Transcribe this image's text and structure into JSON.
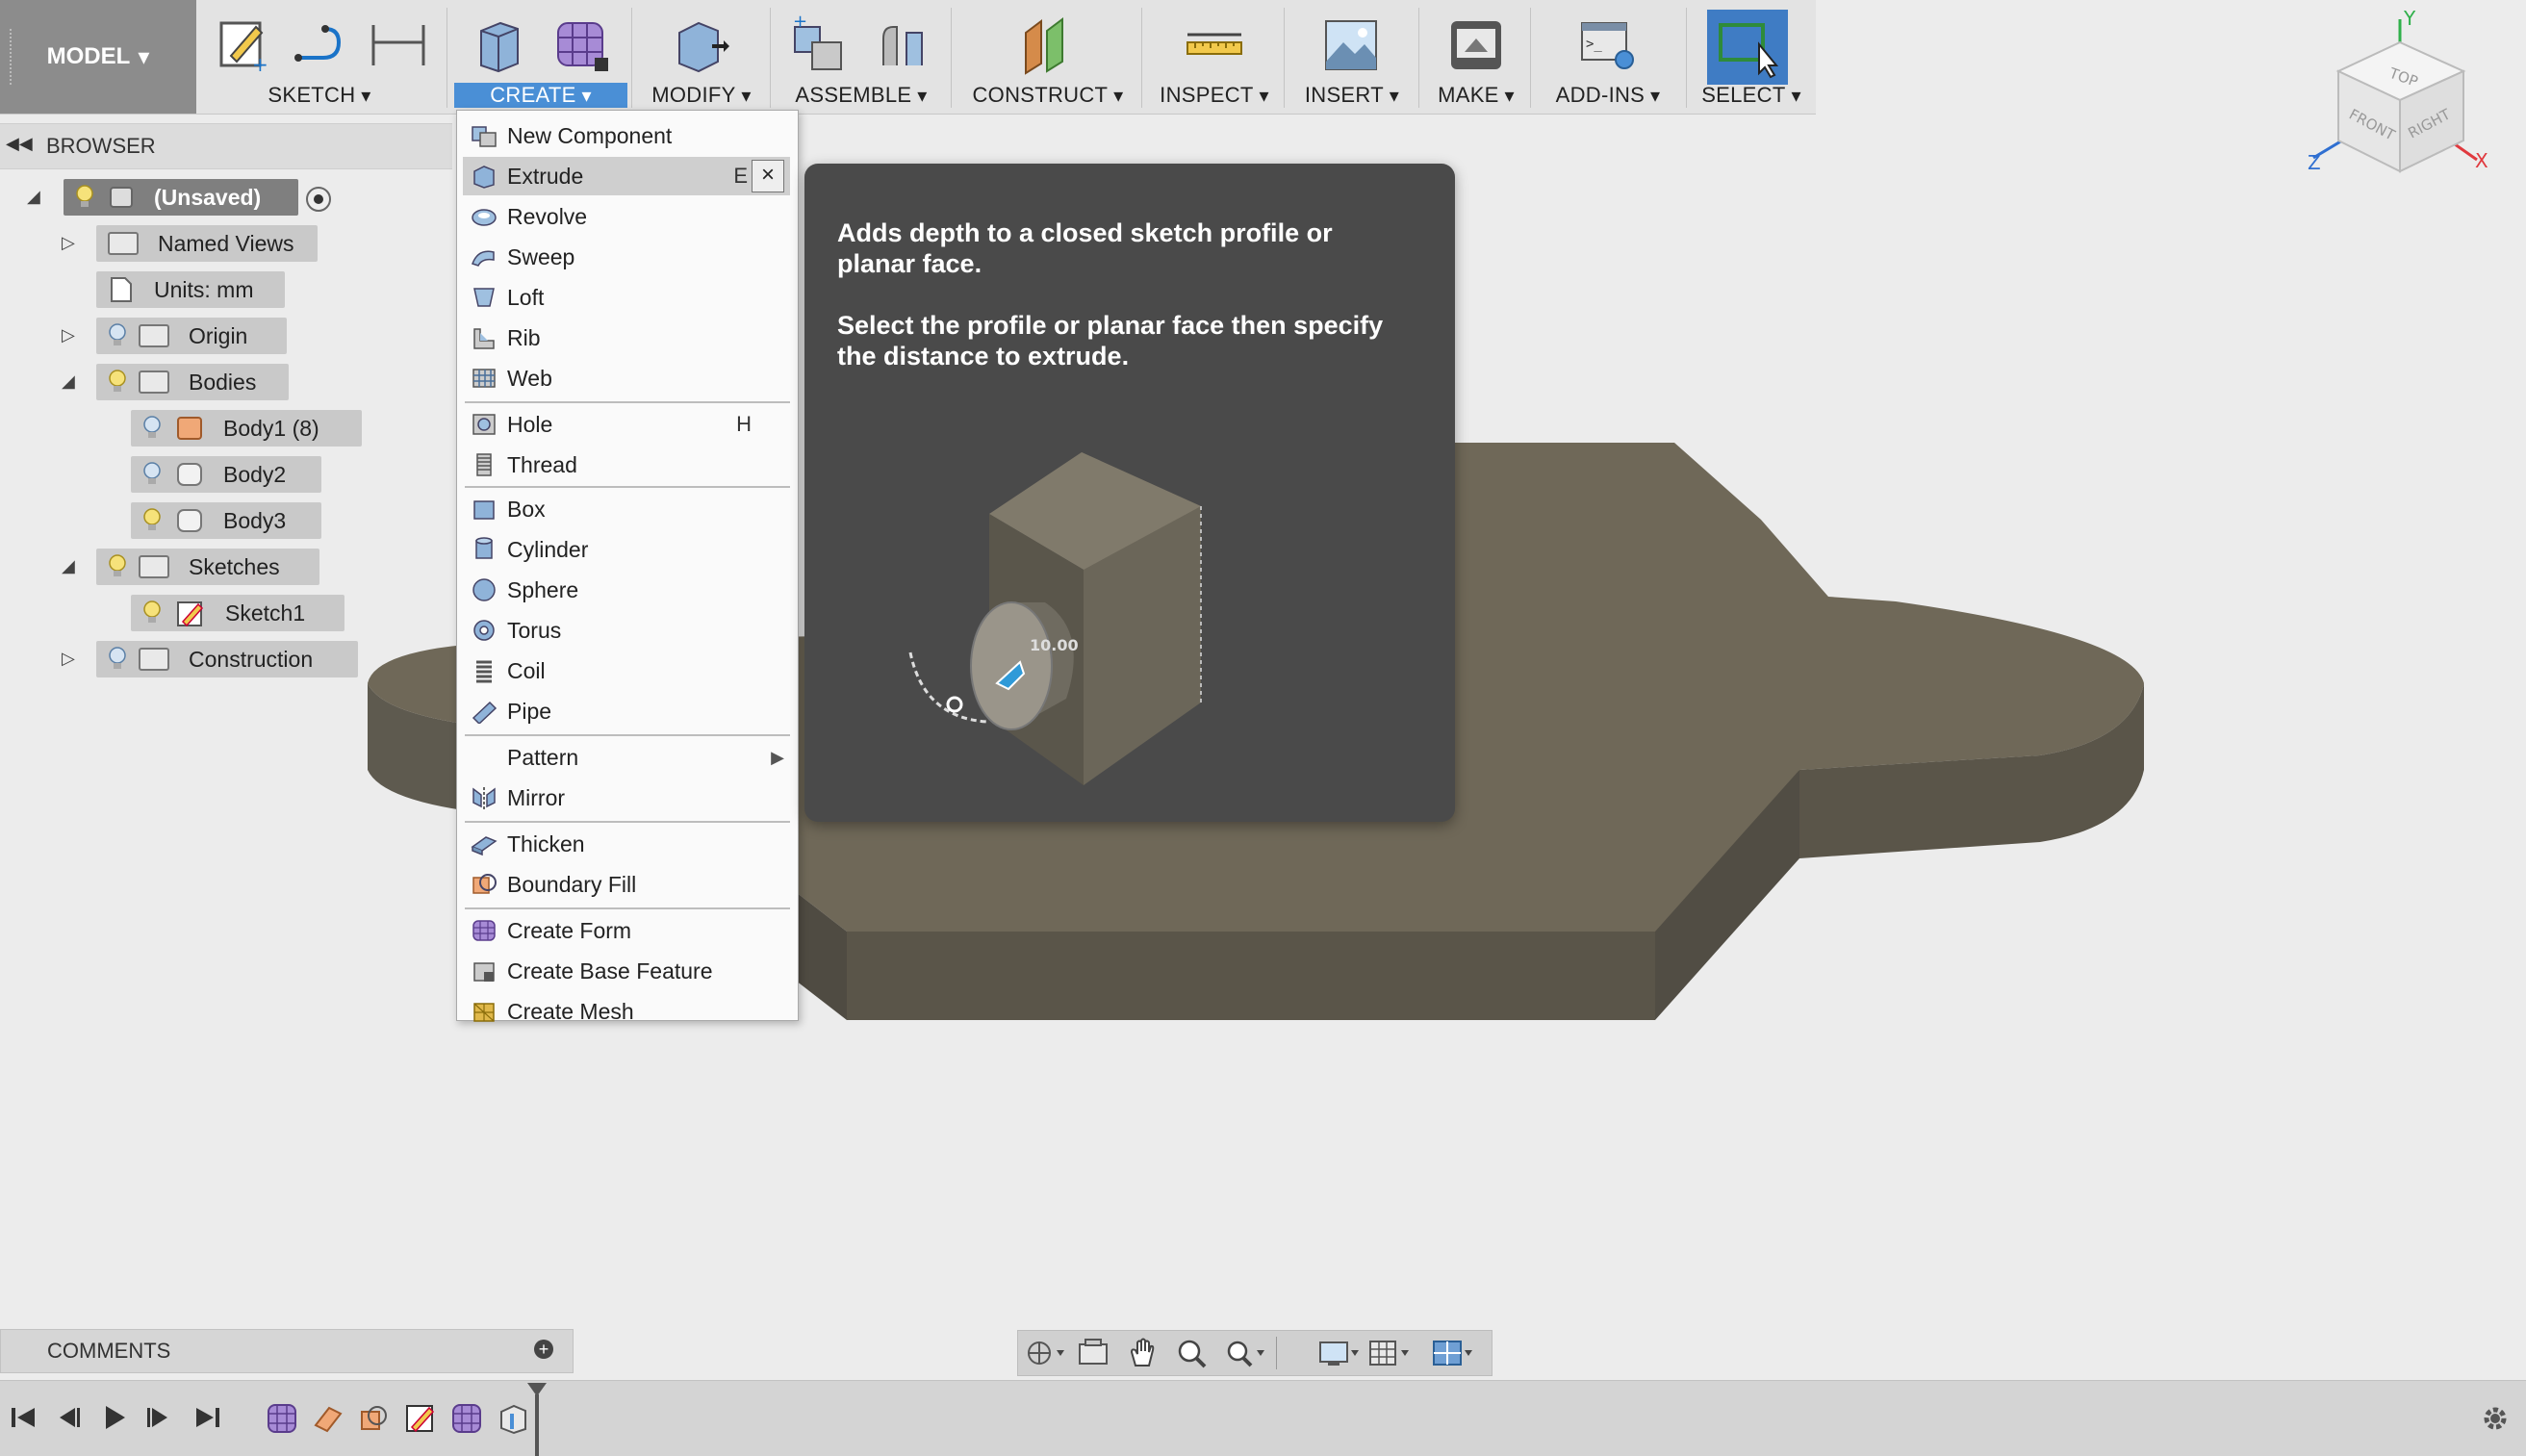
{
  "toolbar": {
    "workspace": "MODEL",
    "groups": [
      "SKETCH",
      "CREATE",
      "MODIFY",
      "ASSEMBLE",
      "CONSTRUCT",
      "INSPECT",
      "INSERT",
      "MAKE",
      "ADD-INS",
      "SELECT"
    ]
  },
  "viewcube": {
    "top": "TOP",
    "front": "FRONT",
    "right": "RIGHT",
    "x": "X",
    "y": "Y",
    "z": "Z"
  },
  "browser": {
    "title": "BROWSER",
    "items": [
      {
        "label": "(Unsaved)"
      },
      {
        "label": "Named Views"
      },
      {
        "label": "Units: mm"
      },
      {
        "label": "Origin"
      },
      {
        "label": "Bodies"
      },
      {
        "label": "Body1 (8)"
      },
      {
        "label": "Body2"
      },
      {
        "label": "Body3"
      },
      {
        "label": "Sketches"
      },
      {
        "label": "Sketch1"
      },
      {
        "label": "Construction"
      }
    ]
  },
  "create_menu": {
    "items": [
      {
        "label": "New Component",
        "shortcut": ""
      },
      {
        "label": "Extrude",
        "shortcut": "E",
        "close": "×"
      },
      {
        "label": "Revolve",
        "shortcut": ""
      },
      {
        "label": "Sweep",
        "shortcut": ""
      },
      {
        "label": "Loft",
        "shortcut": ""
      },
      {
        "label": "Rib",
        "shortcut": ""
      },
      {
        "label": "Web",
        "shortcut": ""
      },
      {
        "label": "Hole",
        "shortcut": "H"
      },
      {
        "label": "Thread",
        "shortcut": ""
      },
      {
        "label": "Box",
        "shortcut": ""
      },
      {
        "label": "Cylinder",
        "shortcut": ""
      },
      {
        "label": "Sphere",
        "shortcut": ""
      },
      {
        "label": "Torus",
        "shortcut": ""
      },
      {
        "label": "Coil",
        "shortcut": ""
      },
      {
        "label": "Pipe",
        "shortcut": ""
      },
      {
        "label": "Pattern",
        "shortcut": ""
      },
      {
        "label": "Mirror",
        "shortcut": ""
      },
      {
        "label": "Thicken",
        "shortcut": ""
      },
      {
        "label": "Boundary Fill",
        "shortcut": ""
      },
      {
        "label": "Create Form",
        "shortcut": ""
      },
      {
        "label": "Create Base Feature",
        "shortcut": ""
      },
      {
        "label": "Create Mesh",
        "shortcut": ""
      }
    ]
  },
  "tooltip": {
    "line1": "Adds depth to a closed sketch profile or planar face.",
    "line2": "Select the profile or planar face then specify the distance to extrude.",
    "dimension": "10.00"
  },
  "comments": {
    "title": "COMMENTS",
    "add": "+"
  },
  "colors": {
    "accent": "#4a8fd6",
    "tooltip_bg": "#4a4a4a",
    "model_face": "#6f6858",
    "model_side": "#5a5549"
  }
}
